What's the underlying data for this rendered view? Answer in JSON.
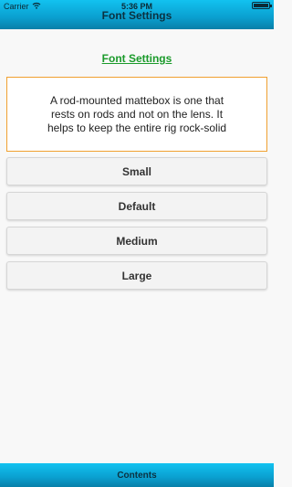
{
  "status_bar": {
    "carrier": "Carrier",
    "time": "5:36 PM",
    "battery_level": 1.0,
    "wifi_icon": "wifi-icon",
    "battery_icon": "battery-icon"
  },
  "nav": {
    "title": "Font Settings"
  },
  "main": {
    "heading": "Font Settings",
    "sample_text": "A rod-mounted mattebox is one that rests on rods and not on the lens. It helps to keep the entire rig rock-solid",
    "buttons": [
      {
        "label": "Small"
      },
      {
        "label": "Default"
      },
      {
        "label": "Medium"
      },
      {
        "label": "Large"
      }
    ]
  },
  "bottom_bar": {
    "label": "Contents"
  },
  "colors": {
    "bar_accent": "#0a9fcf",
    "heading_green": "#1a9a2a",
    "box_border": "#f0a030"
  }
}
